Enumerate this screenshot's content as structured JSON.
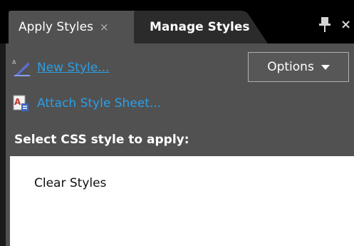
{
  "tabs": [
    {
      "label": "Apply Styles",
      "active": true,
      "close_glyph": "×"
    },
    {
      "label": "Manage Styles",
      "active": false
    }
  ],
  "window_controls": {
    "pin_icon": "pin-icon",
    "close_glyph": "×"
  },
  "actions": {
    "new_style": {
      "label": "New Style...",
      "icon": "new-style-icon"
    },
    "attach_style_sheet": {
      "label": "Attach Style Sheet...",
      "icon": "attach-stylesheet-icon"
    }
  },
  "options": {
    "label": "Options"
  },
  "section": {
    "heading": "Select CSS style to apply:"
  },
  "style_list": {
    "items": [
      "Clear Styles"
    ]
  },
  "colors": {
    "panel_bg": "#515151",
    "tabstrip_bg": "#000000",
    "link": "#2b9fe6",
    "list_bg": "#ffffff"
  }
}
